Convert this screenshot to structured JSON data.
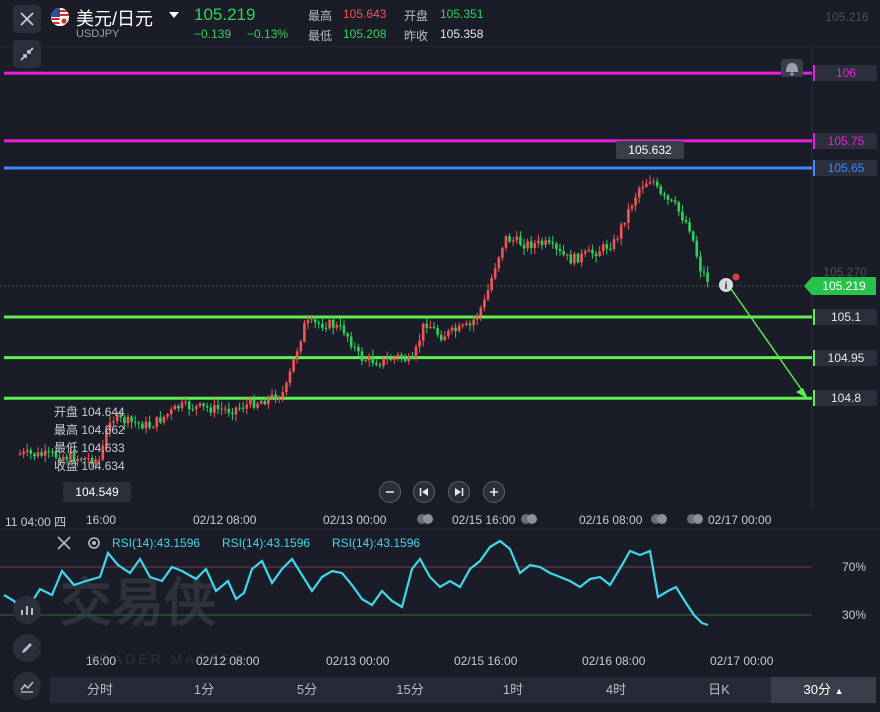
{
  "header": {
    "title": "美元/日元",
    "symbol": "USDJPY",
    "last_price": "105.219",
    "change": "−0.139",
    "change_pct": "−0.13%",
    "high_label": "最高",
    "high_value": "105.643",
    "open_label": "开盘",
    "open_value": "105.351",
    "low_label": "最低",
    "low_value": "105.208",
    "prev_label": "昨收",
    "prev_value": "105.358"
  },
  "price_axis": {
    "top_partial": "105.216",
    "mid_faint": "105.270",
    "current_tag": "105.219",
    "peak_tag": "105.632",
    "low_tag": "104.549"
  },
  "lines": [
    {
      "value": "106",
      "color": "#e81ee0"
    },
    {
      "value": "105.75",
      "color": "#e81ee0"
    },
    {
      "value": "105.65",
      "color": "#3f86ff"
    },
    {
      "value": "105.1",
      "color": "#5ff04f"
    },
    {
      "value": "104.95",
      "color": "#5ff04f"
    },
    {
      "value": "104.8",
      "color": "#5ff04f"
    }
  ],
  "ohlc_tooltip": {
    "open": "开盘 104.644",
    "high": "最高 104.662",
    "low": "最低 104.633",
    "close": "收盘 104.634"
  },
  "time_axis": [
    "11 04:00 四",
    "16:00",
    "02/12 08:00",
    "02/13 00:00",
    "02/15 16:00",
    "02/16 08:00",
    "02/17 00:00"
  ],
  "rsi": {
    "labels": [
      "RSI(14):43.1596",
      "RSI(14):43.1596",
      "RSI(14):43.1596"
    ],
    "level_high": "70%",
    "level_low": "30%",
    "time_axis": [
      "16:00",
      "02/12 08:00",
      "02/13 00:00",
      "02/15 16:00",
      "02/16 08:00",
      "02/17 00:00"
    ],
    "watermark": "交易侠",
    "watermark_sub": "TRADER MASTER"
  },
  "timeframes": [
    "分时",
    "1分",
    "5分",
    "15分",
    "1时",
    "4时",
    "日K",
    "30分"
  ],
  "selected_timeframe": "30分",
  "colors": {
    "up": "#f25454",
    "down": "#2fd05c",
    "rsi_line": "#41d6ea",
    "background": "#1a1d27"
  }
}
